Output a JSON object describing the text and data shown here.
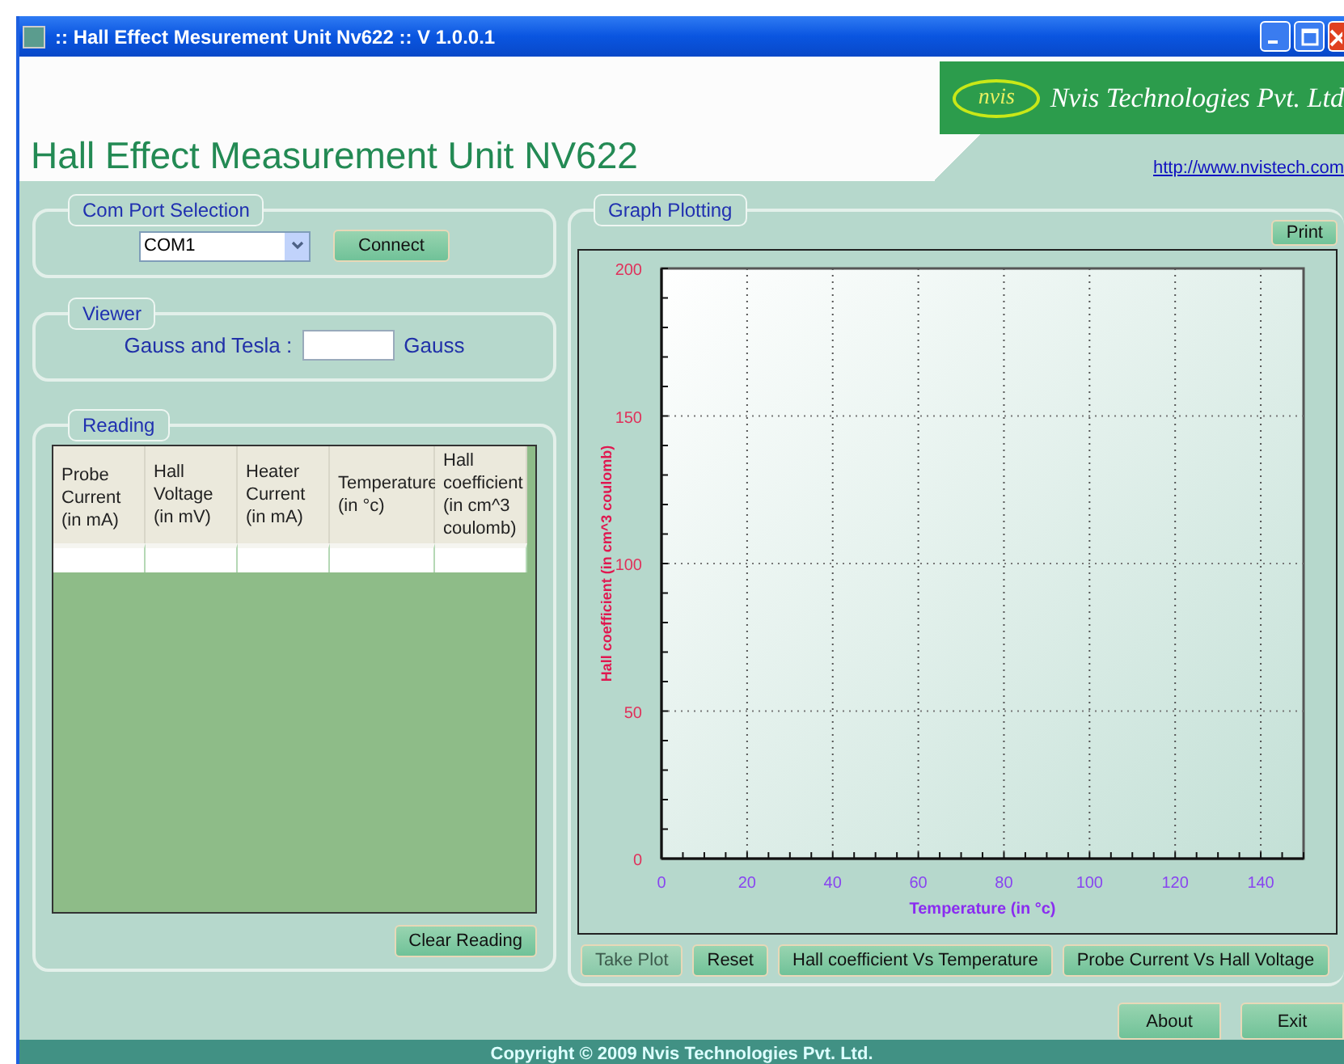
{
  "window": {
    "title": ":: Hall Effect Mesurement Unit Nv622 :: V 1.0.0.1"
  },
  "header": {
    "title": "Hall Effect Measurement Unit NV622",
    "logo_mark": "nvis",
    "logo_text": "Nvis Technologies Pvt. Ltd",
    "url": "http://www.nvistech.com"
  },
  "com_port": {
    "legend": "Com Port Selection",
    "port": "COM1",
    "connect": "Connect"
  },
  "viewer": {
    "legend": "Viewer",
    "label": "Gauss and Tesla :",
    "unit": "Gauss"
  },
  "reading": {
    "legend": "Reading",
    "columns": [
      "Probe Current (in mA)",
      "Hall Voltage (in mV)",
      "Heater Current (in mA)",
      "Temperature (in °c)",
      "Hall coefficient (in cm^3 coulomb)"
    ],
    "clear": "Clear Reading"
  },
  "graph": {
    "legend": "Graph Plotting",
    "print": "Print",
    "chart_data": {
      "type": "line",
      "xlabel": "Temperature (in °c)",
      "ylabel": "Hall coefficient (in cm^3 coulomb)",
      "grid": true,
      "xlim": [
        0,
        150
      ],
      "ylim": [
        0,
        200
      ],
      "xticks": [
        0,
        20,
        40,
        60,
        80,
        100,
        120,
        140
      ],
      "yticks": [
        0,
        50,
        100,
        150,
        200
      ]
    },
    "buttons": [
      {
        "label": "Take Plot",
        "disabled": true
      },
      {
        "label": "Reset",
        "disabled": false
      },
      {
        "label": "Hall coefficient Vs Temperature",
        "disabled": false
      },
      {
        "label": "Probe Current Vs Hall Voltage",
        "disabled": false
      }
    ]
  },
  "footer_buttons": [
    "About",
    "Exit"
  ],
  "status_bar": "Copyright ©  2009 Nvis Technologies Pvt. Ltd."
}
